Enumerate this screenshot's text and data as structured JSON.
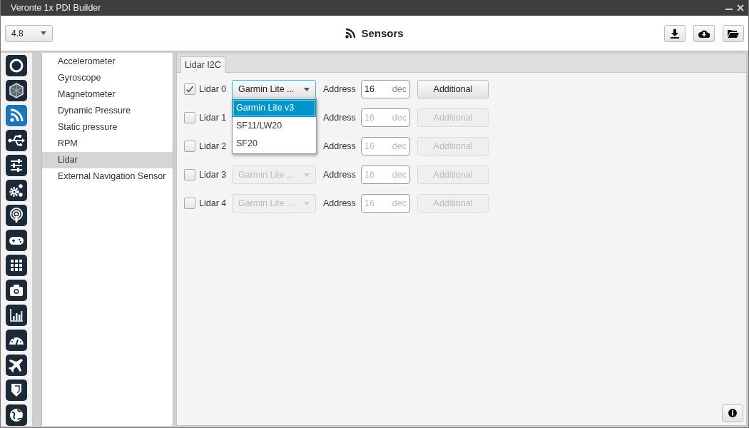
{
  "window": {
    "title": "Veronte 1x PDI Builder"
  },
  "header": {
    "version": "4.8",
    "title": "Sensors"
  },
  "rail": [
    {
      "selected": false
    },
    {
      "selected": false
    },
    {
      "selected": true
    },
    {
      "selected": false
    },
    {
      "selected": false
    },
    {
      "selected": false
    },
    {
      "selected": false
    },
    {
      "selected": false
    },
    {
      "selected": false
    },
    {
      "selected": false
    },
    {
      "selected": false
    },
    {
      "selected": false
    },
    {
      "selected": false
    },
    {
      "selected": false
    },
    {
      "selected": false
    }
  ],
  "sidebar": {
    "items": [
      {
        "label": "Accelerometer",
        "selected": false
      },
      {
        "label": "Gyroscope",
        "selected": false
      },
      {
        "label": "Magnetometer",
        "selected": false
      },
      {
        "label": "Dynamic Pressure",
        "selected": false
      },
      {
        "label": "Static pressure",
        "selected": false
      },
      {
        "label": "RPM",
        "selected": false
      },
      {
        "label": "Lidar",
        "selected": true
      },
      {
        "label": "External Navigation Sensor",
        "selected": false
      }
    ]
  },
  "tabs": [
    {
      "label": "Lidar I2C",
      "selected": true
    }
  ],
  "lidars": [
    {
      "label": "Lidar 0",
      "checked": true,
      "disabled": false,
      "model": "Garmin Lite ...",
      "address_label": "Address",
      "address": "16",
      "unit": "dec",
      "button": "Additional"
    },
    {
      "label": "Lidar 1",
      "checked": false,
      "disabled": true,
      "address_label": "Address",
      "address": "16",
      "unit": "dec",
      "button": "Additional"
    },
    {
      "label": "Lidar 2",
      "checked": false,
      "disabled": true,
      "address_label": "Address",
      "address": "16",
      "unit": "dec",
      "button": "Additional"
    },
    {
      "label": "Lidar 3",
      "checked": false,
      "disabled": true,
      "model": "Garmin Lite ...",
      "address_label": "Address",
      "address": "16",
      "unit": "dec",
      "button": "Additional"
    },
    {
      "label": "Lidar 4",
      "checked": false,
      "disabled": true,
      "model": "Garmin Lite ...",
      "address_label": "Address",
      "address": "16",
      "unit": "dec",
      "button": "Additional"
    }
  ],
  "dropdown": {
    "options": [
      {
        "label": "Garmin Lite v3",
        "selected": true
      },
      {
        "label": "SF11/LW20",
        "selected": false
      },
      {
        "label": "SF20",
        "selected": false
      }
    ]
  }
}
